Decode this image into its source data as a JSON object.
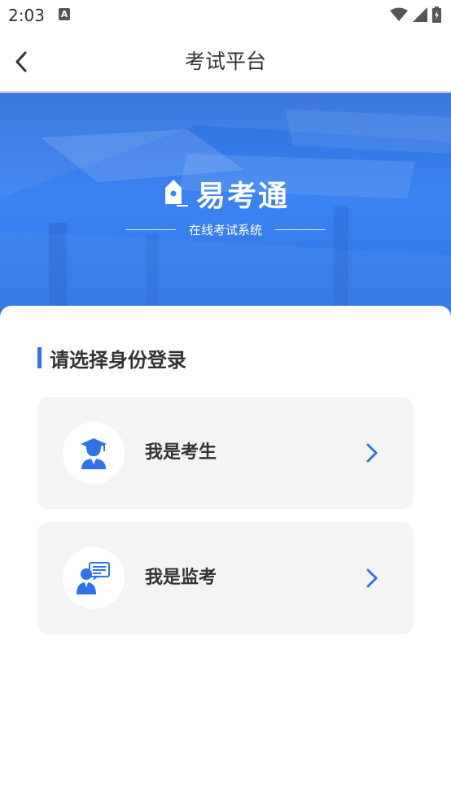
{
  "status_bar": {
    "time": "2:03",
    "notification_icon_letter": "A",
    "icons": [
      "wifi-icon",
      "signal-icon",
      "battery-charging-icon"
    ]
  },
  "nav": {
    "title": "考试平台",
    "back_icon": "chevron-left-icon"
  },
  "banner": {
    "brand_name": "易考通",
    "subtitle": "在线考试系统",
    "logo_icon": "pen-nib-icon"
  },
  "login": {
    "section_title": "请选择身份登录",
    "roles": [
      {
        "label": "我是考生",
        "icon": "graduate-student-icon"
      },
      {
        "label": "我是监考",
        "icon": "proctor-presenter-icon"
      }
    ]
  },
  "colors": {
    "accent": "#2f74e6",
    "banner_blue": "#3b82f2",
    "card_bg": "#f4f4f4",
    "text_dark": "#333333"
  }
}
